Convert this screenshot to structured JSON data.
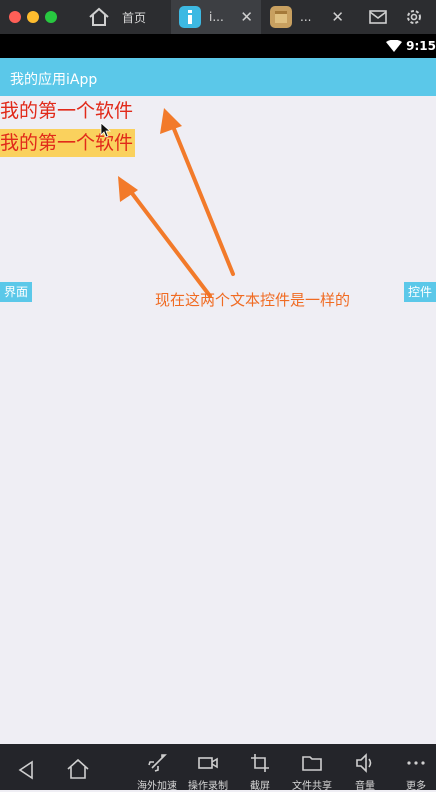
{
  "window": {
    "tabs": [
      {
        "label": "首页"
      },
      {
        "label": "i..."
      },
      {
        "label": "..."
      }
    ]
  },
  "status": {
    "time": "9:15"
  },
  "app": {
    "title": "我的应用iApp"
  },
  "content": {
    "text1": "我的第一个软件",
    "text2": "我的第一个软件",
    "left_tag": "界面",
    "right_tag": "控件",
    "annotation": "现在这两个文本控件是一样的"
  },
  "bottom": {
    "items": [
      {
        "label": "海外加速",
        "icon": "rocket-icon"
      },
      {
        "label": "操作录制",
        "icon": "video-icon"
      },
      {
        "label": "截屏",
        "icon": "crop-icon"
      },
      {
        "label": "文件共享",
        "icon": "folder-icon"
      },
      {
        "label": "音量",
        "icon": "speaker-icon"
      },
      {
        "label": "更多",
        "icon": "more-icon"
      }
    ]
  },
  "colors": {
    "accent": "#5bc8e9",
    "text_red": "#e12a1a",
    "highlight": "#fad15d",
    "annotation": "#f06b22"
  }
}
